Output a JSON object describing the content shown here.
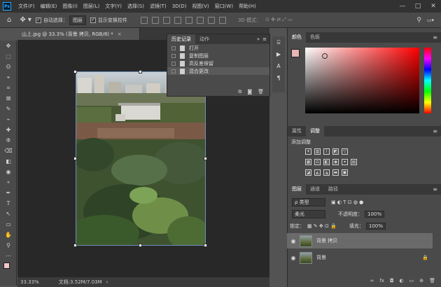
{
  "menubar": {
    "logo": "Ps",
    "items": [
      "文件(F)",
      "编辑(E)",
      "图像(I)",
      "图层(L)",
      "文字(Y)",
      "选择(S)",
      "滤镜(T)",
      "3D(D)",
      "视图(V)",
      "窗口(W)",
      "帮助(H)"
    ],
    "window_controls": [
      "—",
      "□",
      "✕"
    ]
  },
  "options": {
    "home_icon": "home-icon",
    "auto_select_label": "自动选择：",
    "auto_select_value": "图层",
    "show_transform_label": "显示变换控件",
    "mode_3d_label": "3D 模式："
  },
  "toolbar": {
    "tools": [
      "✥",
      "⬚",
      "ʘ",
      "⌖",
      "⌗",
      "⊠",
      "✎",
      "⌁",
      "✚",
      "⟰",
      "⌫",
      "◧",
      "◉",
      "⚬",
      "✒",
      "T",
      "↖",
      "▭",
      "✋",
      "⚲",
      "⋯"
    ]
  },
  "document": {
    "tab_title": "山上.jpg @ 33.3% (背景 拷贝, RGB/8) *",
    "tab_close": "×",
    "zoom": "33.33%",
    "doc_size": "文档:3.52M/7.03M",
    "status_arrow": "›"
  },
  "history": {
    "tabs": [
      "历史记录",
      "动作"
    ],
    "expand": "»",
    "menu": "≡",
    "items": [
      "打开",
      "复制图层",
      "高反差保留",
      "混合更改"
    ]
  },
  "right": {
    "color_tabs": [
      "颜色",
      "色板"
    ],
    "adjust_tabs": [
      "属性",
      "调整"
    ],
    "adjust_title": "添加调整",
    "layers_tabs": [
      "图层",
      "通道",
      "路径"
    ],
    "kind_label": "ρ 类型",
    "blend_mode": "柔光",
    "opacity_label": "不透明度：",
    "opacity_value": "100%",
    "lock_label": "锁定：",
    "fill_label": "填充：",
    "fill_value": "100%",
    "layers": [
      {
        "name": "背景 拷贝",
        "selected": true
      },
      {
        "name": "背景",
        "locked": true
      }
    ],
    "footer_icons": [
      "∞",
      "fx",
      "◘",
      "◐",
      "▭",
      "⊕",
      "🗑"
    ]
  },
  "colors": {
    "accent": "#31a8ff",
    "app_bg": "#535353",
    "panel": "#4a4a4a",
    "selection": "#6a6a6a",
    "fg_swatch": "#e8b4b4",
    "bg_swatch": "#8b1a1a"
  }
}
